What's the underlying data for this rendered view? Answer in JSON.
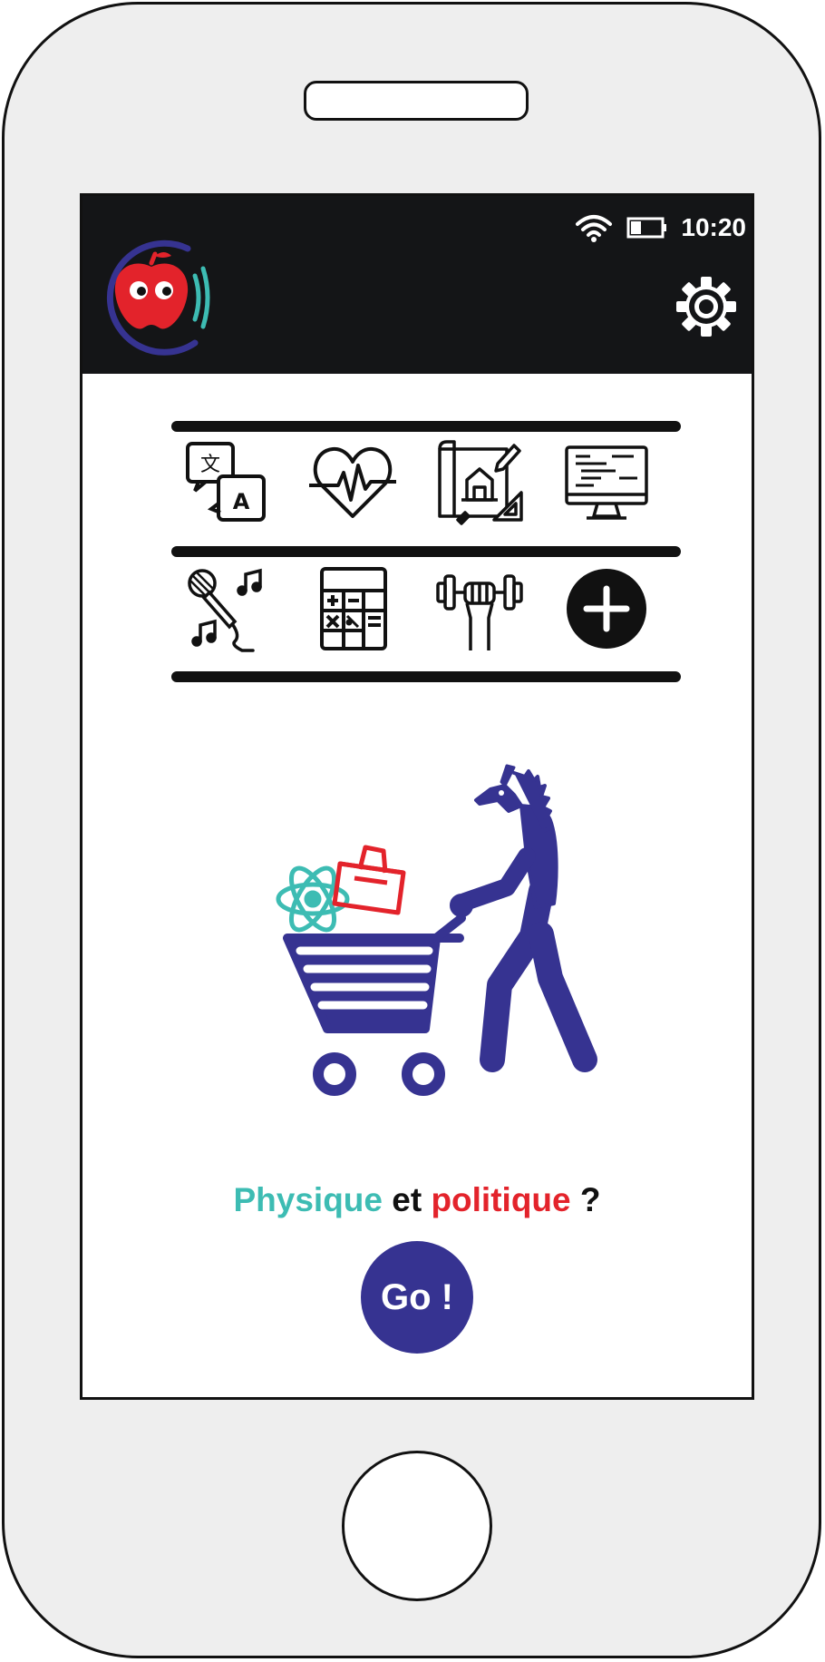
{
  "device": {
    "type": "smartphone mockup"
  },
  "status_bar": {
    "time": "10:20",
    "icons": [
      "wifi-icon",
      "battery-icon"
    ]
  },
  "app_bar": {
    "logo": "apple-with-eyes-logo",
    "settings_icon": "gear-icon"
  },
  "categories": [
    {
      "icon": "translate-icon"
    },
    {
      "icon": "heartbeat-icon"
    },
    {
      "icon": "architecture-blueprint-icon"
    },
    {
      "icon": "computer-code-icon"
    },
    {
      "icon": "microphone-music-icon"
    },
    {
      "icon": "calculator-icon"
    },
    {
      "icon": "dumbbell-fitness-icon"
    },
    {
      "icon": "add-plus-icon"
    }
  ],
  "illustration": {
    "description": "unicorn-pushing-shopping-cart",
    "items": [
      "atom-icon",
      "ballot-box-icon"
    ]
  },
  "question": {
    "part1": "Physique",
    "part2": "et",
    "part3": "politique",
    "part4": "?"
  },
  "go_button": {
    "label": "Go !"
  },
  "colors": {
    "teal": "#3dbcb3",
    "red": "#e3232b",
    "navy": "#363391",
    "black": "#141517"
  }
}
